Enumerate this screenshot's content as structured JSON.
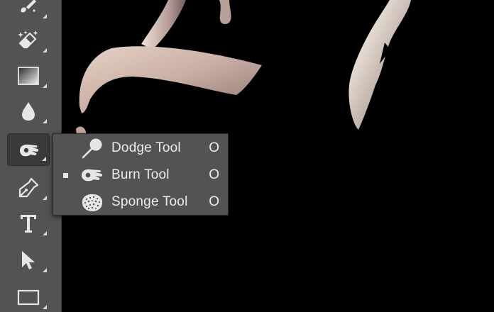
{
  "toolbar": {
    "tools": [
      {
        "name": "brush-tool",
        "icon": "brush-icon"
      },
      {
        "name": "magic-eraser-tool",
        "icon": "magic-eraser-icon"
      },
      {
        "name": "gradient-tool",
        "icon": "gradient-icon"
      },
      {
        "name": "blur-tool",
        "icon": "drop-icon"
      },
      {
        "name": "burn-tool",
        "icon": "burn-hand-icon",
        "active": true
      },
      {
        "name": "pen-tool",
        "icon": "pen-nib-icon"
      },
      {
        "name": "type-tool",
        "icon": "type-icon",
        "glyph": "T"
      },
      {
        "name": "path-selection-tool",
        "icon": "arrow-pointer-icon"
      },
      {
        "name": "rectangle-tool",
        "icon": "rectangle-icon"
      }
    ]
  },
  "flyout": {
    "items": [
      {
        "label": "Dodge Tool",
        "shortcut": "O",
        "icon": "dodge-lollipop-icon",
        "selected": false
      },
      {
        "label": "Burn Tool",
        "shortcut": "O",
        "icon": "burn-hand-icon",
        "selected": true
      },
      {
        "label": "Sponge Tool",
        "shortcut": "O",
        "icon": "sponge-icon",
        "selected": false
      }
    ]
  },
  "colors": {
    "toolbar_bg": "#535353",
    "canvas_bg": "#000000",
    "flyout_bg": "#535353",
    "text": "#ececec"
  }
}
